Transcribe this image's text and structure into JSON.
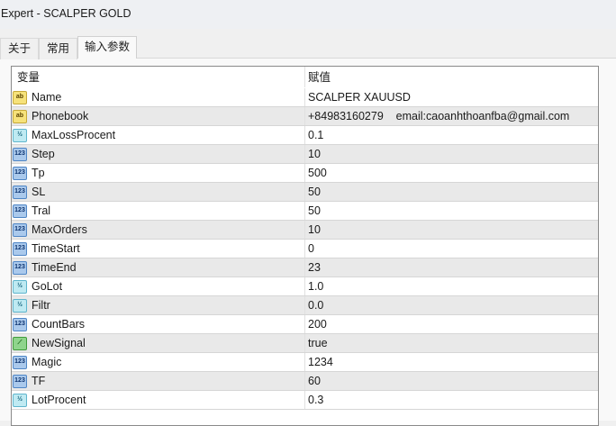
{
  "window": {
    "title": "Expert - SCALPER GOLD"
  },
  "tabs": [
    {
      "label": "关于"
    },
    {
      "label": "常用"
    },
    {
      "label": "输入参数",
      "active": true
    }
  ],
  "table": {
    "headers": [
      "变量",
      "赋值"
    ],
    "rows": [
      {
        "type": "string",
        "icon": "ab",
        "name": "Name",
        "value": "SCALPER XAUUSD"
      },
      {
        "type": "string",
        "icon": "ab",
        "name": "Phonebook",
        "value": "+84983160279    email:caoanhthoanfba@gmail.com"
      },
      {
        "type": "double",
        "icon": "½",
        "name": "MaxLossProcent",
        "value": "0.1"
      },
      {
        "type": "int",
        "icon": "123",
        "name": "Step",
        "value": "10"
      },
      {
        "type": "int",
        "icon": "123",
        "name": "Tp",
        "value": "500"
      },
      {
        "type": "int",
        "icon": "123",
        "name": "SL",
        "value": "50"
      },
      {
        "type": "int",
        "icon": "123",
        "name": "Tral",
        "value": "50"
      },
      {
        "type": "int",
        "icon": "123",
        "name": "MaxOrders",
        "value": "10"
      },
      {
        "type": "int",
        "icon": "123",
        "name": "TimeStart",
        "value": "0"
      },
      {
        "type": "int",
        "icon": "123",
        "name": "TimeEnd",
        "value": "23"
      },
      {
        "type": "double",
        "icon": "½",
        "name": "GoLot",
        "value": "1.0"
      },
      {
        "type": "double",
        "icon": "½",
        "name": "Filtr",
        "value": "0.0"
      },
      {
        "type": "int",
        "icon": "123",
        "name": "CountBars",
        "value": "200"
      },
      {
        "type": "bool",
        "icon": "⟋",
        "name": "NewSignal",
        "value": "true"
      },
      {
        "type": "int",
        "icon": "123",
        "name": "Magic",
        "value": "1234"
      },
      {
        "type": "int",
        "icon": "123",
        "name": "TF",
        "value": "60"
      },
      {
        "type": "double",
        "icon": "½",
        "name": "LotProcent",
        "value": "0.3"
      }
    ]
  }
}
